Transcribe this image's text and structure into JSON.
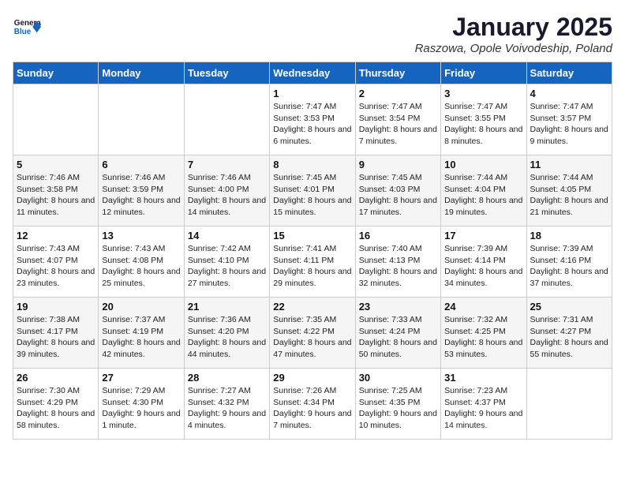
{
  "header": {
    "logo": {
      "general": "General",
      "blue": "Blue"
    },
    "title": "January 2025",
    "location": "Raszowa, Opole Voivodeship, Poland"
  },
  "weekdays": [
    "Sunday",
    "Monday",
    "Tuesday",
    "Wednesday",
    "Thursday",
    "Friday",
    "Saturday"
  ],
  "weeks": [
    [
      {
        "day": "",
        "sunrise": "",
        "sunset": "",
        "daylight": ""
      },
      {
        "day": "",
        "sunrise": "",
        "sunset": "",
        "daylight": ""
      },
      {
        "day": "",
        "sunrise": "",
        "sunset": "",
        "daylight": ""
      },
      {
        "day": "1",
        "sunrise": "Sunrise: 7:47 AM",
        "sunset": "Sunset: 3:53 PM",
        "daylight": "Daylight: 8 hours and 6 minutes."
      },
      {
        "day": "2",
        "sunrise": "Sunrise: 7:47 AM",
        "sunset": "Sunset: 3:54 PM",
        "daylight": "Daylight: 8 hours and 7 minutes."
      },
      {
        "day": "3",
        "sunrise": "Sunrise: 7:47 AM",
        "sunset": "Sunset: 3:55 PM",
        "daylight": "Daylight: 8 hours and 8 minutes."
      },
      {
        "day": "4",
        "sunrise": "Sunrise: 7:47 AM",
        "sunset": "Sunset: 3:57 PM",
        "daylight": "Daylight: 8 hours and 9 minutes."
      }
    ],
    [
      {
        "day": "5",
        "sunrise": "Sunrise: 7:46 AM",
        "sunset": "Sunset: 3:58 PM",
        "daylight": "Daylight: 8 hours and 11 minutes."
      },
      {
        "day": "6",
        "sunrise": "Sunrise: 7:46 AM",
        "sunset": "Sunset: 3:59 PM",
        "daylight": "Daylight: 8 hours and 12 minutes."
      },
      {
        "day": "7",
        "sunrise": "Sunrise: 7:46 AM",
        "sunset": "Sunset: 4:00 PM",
        "daylight": "Daylight: 8 hours and 14 minutes."
      },
      {
        "day": "8",
        "sunrise": "Sunrise: 7:45 AM",
        "sunset": "Sunset: 4:01 PM",
        "daylight": "Daylight: 8 hours and 15 minutes."
      },
      {
        "day": "9",
        "sunrise": "Sunrise: 7:45 AM",
        "sunset": "Sunset: 4:03 PM",
        "daylight": "Daylight: 8 hours and 17 minutes."
      },
      {
        "day": "10",
        "sunrise": "Sunrise: 7:44 AM",
        "sunset": "Sunset: 4:04 PM",
        "daylight": "Daylight: 8 hours and 19 minutes."
      },
      {
        "day": "11",
        "sunrise": "Sunrise: 7:44 AM",
        "sunset": "Sunset: 4:05 PM",
        "daylight": "Daylight: 8 hours and 21 minutes."
      }
    ],
    [
      {
        "day": "12",
        "sunrise": "Sunrise: 7:43 AM",
        "sunset": "Sunset: 4:07 PM",
        "daylight": "Daylight: 8 hours and 23 minutes."
      },
      {
        "day": "13",
        "sunrise": "Sunrise: 7:43 AM",
        "sunset": "Sunset: 4:08 PM",
        "daylight": "Daylight: 8 hours and 25 minutes."
      },
      {
        "day": "14",
        "sunrise": "Sunrise: 7:42 AM",
        "sunset": "Sunset: 4:10 PM",
        "daylight": "Daylight: 8 hours and 27 minutes."
      },
      {
        "day": "15",
        "sunrise": "Sunrise: 7:41 AM",
        "sunset": "Sunset: 4:11 PM",
        "daylight": "Daylight: 8 hours and 29 minutes."
      },
      {
        "day": "16",
        "sunrise": "Sunrise: 7:40 AM",
        "sunset": "Sunset: 4:13 PM",
        "daylight": "Daylight: 8 hours and 32 minutes."
      },
      {
        "day": "17",
        "sunrise": "Sunrise: 7:39 AM",
        "sunset": "Sunset: 4:14 PM",
        "daylight": "Daylight: 8 hours and 34 minutes."
      },
      {
        "day": "18",
        "sunrise": "Sunrise: 7:39 AM",
        "sunset": "Sunset: 4:16 PM",
        "daylight": "Daylight: 8 hours and 37 minutes."
      }
    ],
    [
      {
        "day": "19",
        "sunrise": "Sunrise: 7:38 AM",
        "sunset": "Sunset: 4:17 PM",
        "daylight": "Daylight: 8 hours and 39 minutes."
      },
      {
        "day": "20",
        "sunrise": "Sunrise: 7:37 AM",
        "sunset": "Sunset: 4:19 PM",
        "daylight": "Daylight: 8 hours and 42 minutes."
      },
      {
        "day": "21",
        "sunrise": "Sunrise: 7:36 AM",
        "sunset": "Sunset: 4:20 PM",
        "daylight": "Daylight: 8 hours and 44 minutes."
      },
      {
        "day": "22",
        "sunrise": "Sunrise: 7:35 AM",
        "sunset": "Sunset: 4:22 PM",
        "daylight": "Daylight: 8 hours and 47 minutes."
      },
      {
        "day": "23",
        "sunrise": "Sunrise: 7:33 AM",
        "sunset": "Sunset: 4:24 PM",
        "daylight": "Daylight: 8 hours and 50 minutes."
      },
      {
        "day": "24",
        "sunrise": "Sunrise: 7:32 AM",
        "sunset": "Sunset: 4:25 PM",
        "daylight": "Daylight: 8 hours and 53 minutes."
      },
      {
        "day": "25",
        "sunrise": "Sunrise: 7:31 AM",
        "sunset": "Sunset: 4:27 PM",
        "daylight": "Daylight: 8 hours and 55 minutes."
      }
    ],
    [
      {
        "day": "26",
        "sunrise": "Sunrise: 7:30 AM",
        "sunset": "Sunset: 4:29 PM",
        "daylight": "Daylight: 8 hours and 58 minutes."
      },
      {
        "day": "27",
        "sunrise": "Sunrise: 7:29 AM",
        "sunset": "Sunset: 4:30 PM",
        "daylight": "Daylight: 9 hours and 1 minute."
      },
      {
        "day": "28",
        "sunrise": "Sunrise: 7:27 AM",
        "sunset": "Sunset: 4:32 PM",
        "daylight": "Daylight: 9 hours and 4 minutes."
      },
      {
        "day": "29",
        "sunrise": "Sunrise: 7:26 AM",
        "sunset": "Sunset: 4:34 PM",
        "daylight": "Daylight: 9 hours and 7 minutes."
      },
      {
        "day": "30",
        "sunrise": "Sunrise: 7:25 AM",
        "sunset": "Sunset: 4:35 PM",
        "daylight": "Daylight: 9 hours and 10 minutes."
      },
      {
        "day": "31",
        "sunrise": "Sunrise: 7:23 AM",
        "sunset": "Sunset: 4:37 PM",
        "daylight": "Daylight: 9 hours and 14 minutes."
      },
      {
        "day": "",
        "sunrise": "",
        "sunset": "",
        "daylight": ""
      }
    ]
  ]
}
